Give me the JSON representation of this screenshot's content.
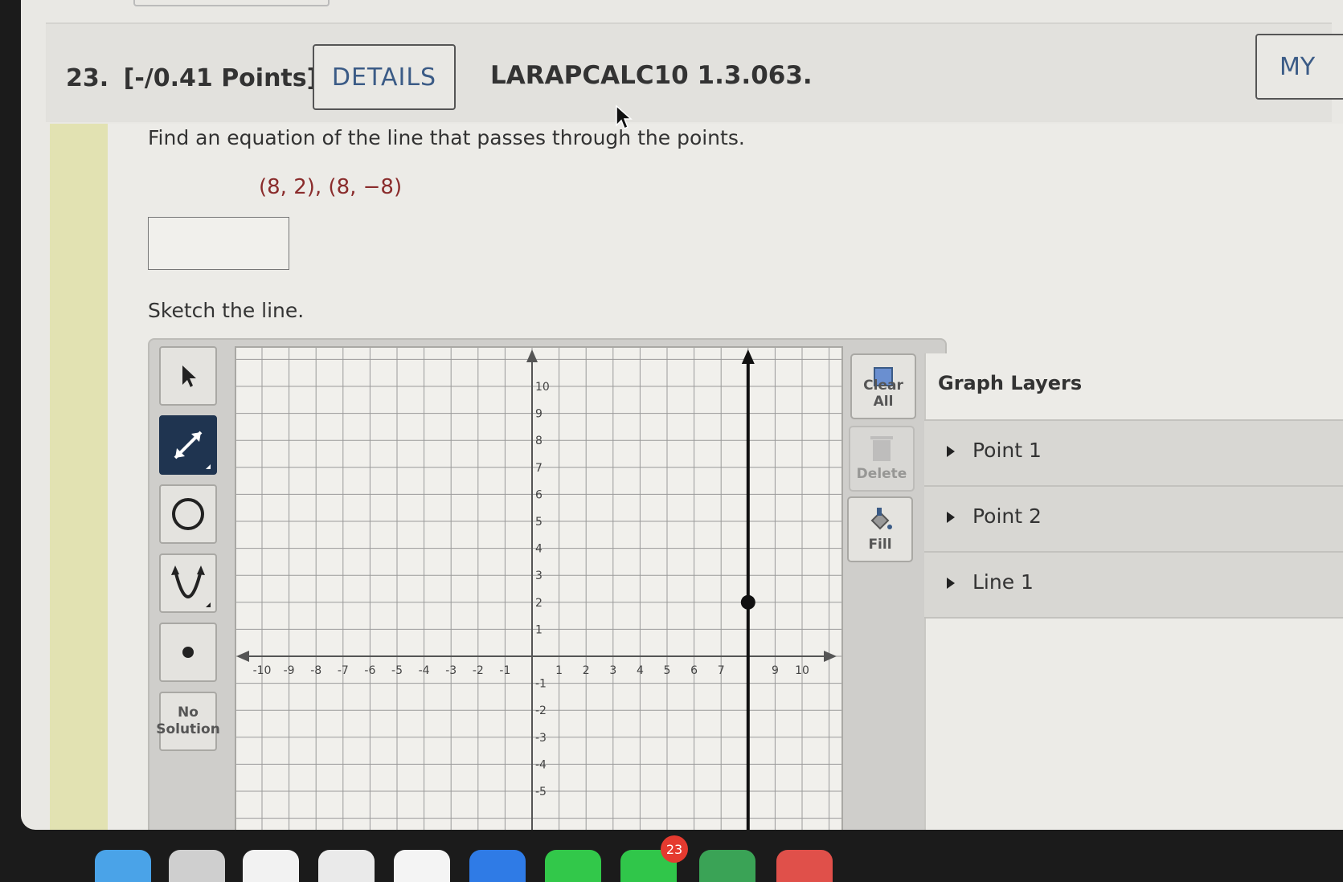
{
  "header": {
    "question_number": "23.",
    "points": "[-/0.41 Points]",
    "details_label": "DETAILS",
    "problem_code": "LARAPCALC10 1.3.063.",
    "my_notes_label": "MY"
  },
  "question": {
    "prompt": "Find an equation of the line that passes through the points.",
    "points_text": "(8, 2), (8, −8)",
    "answer_value": "",
    "sketch_prompt": "Sketch the line."
  },
  "tools": [
    {
      "name": "select",
      "icon": "arrow-cursor-icon"
    },
    {
      "name": "line",
      "icon": "line-segment-icon",
      "active": true
    },
    {
      "name": "circle",
      "icon": "circle-icon"
    },
    {
      "name": "parabola",
      "icon": "parabola-icon"
    },
    {
      "name": "point",
      "icon": "point-icon"
    },
    {
      "name": "no-solution",
      "label": "No Solution"
    }
  ],
  "right_tools": {
    "clear_all": "Clear All",
    "delete": "Delete",
    "fill": "Fill"
  },
  "graph": {
    "x_ticks": [
      "-10",
      "-9",
      "-8",
      "-7",
      "-6",
      "-5",
      "-4",
      "-3",
      "-2",
      "-1",
      "1",
      "2",
      "3",
      "4",
      "5",
      "6",
      "7",
      "9",
      "10"
    ],
    "y_ticks": [
      "10",
      "9",
      "8",
      "7",
      "6",
      "5",
      "4",
      "3",
      "2",
      "1",
      "-1",
      "-2",
      "-3",
      "-4",
      "-5"
    ],
    "plotted_line": {
      "x": 8
    },
    "plotted_point": {
      "x": 8,
      "y": 2
    }
  },
  "layers": {
    "title": "Graph Layers",
    "items": [
      "Point 1",
      "Point 2",
      "Line 1"
    ]
  },
  "dock": {
    "badge": "23"
  },
  "colors": {
    "accent_link": "#3b5b86",
    "points_text": "#8a2c2c",
    "active_tool": "#1f3450",
    "sidebar_accent": "#e2e2b2"
  }
}
